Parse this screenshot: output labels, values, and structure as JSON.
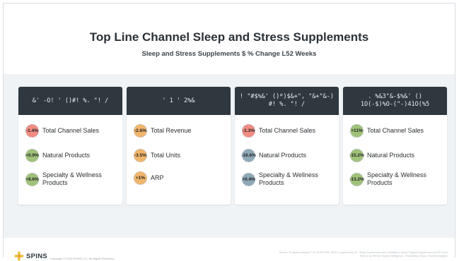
{
  "header": {
    "title": "Top Line Channel Sleep and Stress Supplements",
    "subtitle": "Sleep and Stress Supplements $ % Change L52 Weeks"
  },
  "colors": {
    "card_header": "#2f383f",
    "content_background": "#eff3f6",
    "badge_red": "#f28b82",
    "badge_green": "#9fc279",
    "badge_orange": "#f2b66b",
    "badge_blue": "#8fa9b8"
  },
  "cards": [
    {
      "header": "&' -O! ' ()#! %. \"! /",
      "metrics": [
        {
          "value": "-1.4%",
          "label": "Total Channel Sales",
          "color": "#f28b82"
        },
        {
          "value": "+0.9%",
          "label": "Natural Products",
          "color": "#9fc279"
        },
        {
          "value": "+8.6%",
          "label": "Specialty & Wellness Products",
          "color": "#9fc279"
        }
      ]
    },
    {
      "header": "' 1 ' 2%&",
      "metrics": [
        {
          "value": "-2.6%",
          "label": "Total Revenue",
          "color": "#f2b66b"
        },
        {
          "value": "-3.5%",
          "label": "Total Units",
          "color": "#f2b66b"
        },
        {
          "value": "+1%",
          "label": "ARP",
          "color": "#f2b66b"
        }
      ]
    },
    {
      "header": "! \"#$%&' ()*)$&+\", \"&+\"&-)\n#! %. \"! /",
      "metrics": [
        {
          "value": "-1.3%",
          "label": "Total Channel Sales",
          "color": "#f28b82"
        },
        {
          "value": "-16.6%",
          "label": "Natural Products",
          "color": "#8fa9b8"
        },
        {
          "value": "+0.4%",
          "label": "Specialty & Wellness Products",
          "color": "#8fa9b8"
        }
      ]
    },
    {
      "header": ". %&3\"&-$%&' ()\n1O(-$)%O-(\"-)41O(%5",
      "metrics": [
        {
          "value": "+11%",
          "label": "Total Channel Sales",
          "color": "#9fc279"
        },
        {
          "value": "-15.2%",
          "label": "Natural Products",
          "color": "#9fc279"
        },
        {
          "value": "-13.2%",
          "label": "Specialty & Wellness Products",
          "color": "#9fc279"
        }
      ]
    }
  ],
  "footer": {
    "logo": "SPINS",
    "copyright": "Copyright © 2022 SPINS LLC. All Rights Reserved.",
    "source_line1": "Source: 52 weeks ending 8.7.22 SPINS ENC, MULO, powered by IRi · Sleep Supplements and Calmative & Mood Support Supplements at UPC level",
    "source_line2": "Filtered by SPINS Product Intelligence – Positioning Group, Channel Analytics"
  }
}
